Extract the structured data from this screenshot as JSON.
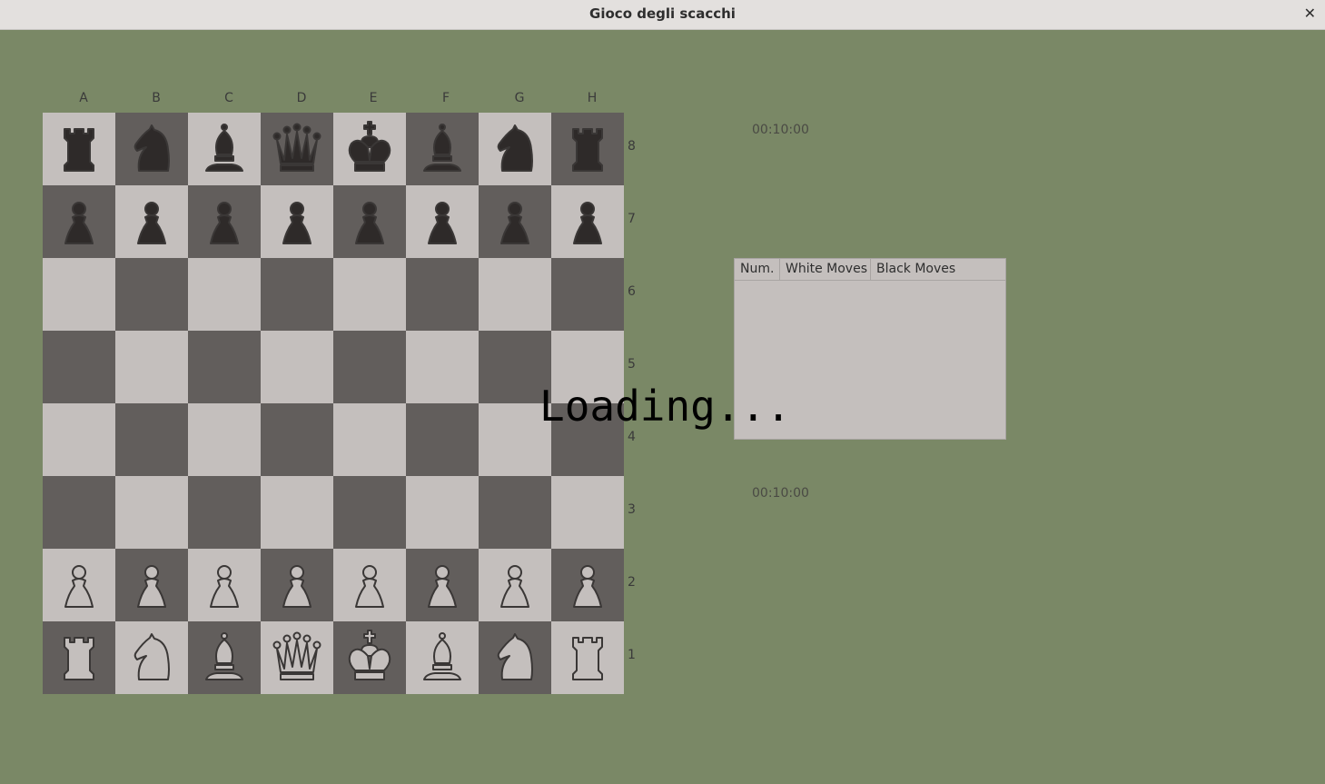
{
  "window": {
    "title": "Gioco degli scacchi",
    "close_glyph": "✕"
  },
  "board": {
    "files": [
      "A",
      "B",
      "C",
      "D",
      "E",
      "F",
      "G",
      "H"
    ],
    "ranks": [
      "8",
      "7",
      "6",
      "5",
      "4",
      "3",
      "2",
      "1"
    ],
    "pieces": [
      [
        "bR",
        "bN",
        "bB",
        "bQ",
        "bK",
        "bB",
        "bN",
        "bR"
      ],
      [
        "bP",
        "bP",
        "bP",
        "bP",
        "bP",
        "bP",
        "bP",
        "bP"
      ],
      [
        "",
        "",
        "",
        "",
        "",
        "",
        "",
        ""
      ],
      [
        "",
        "",
        "",
        "",
        "",
        "",
        "",
        ""
      ],
      [
        "",
        "",
        "",
        "",
        "",
        "",
        "",
        ""
      ],
      [
        "",
        "",
        "",
        "",
        "",
        "",
        "",
        ""
      ],
      [
        "wP",
        "wP",
        "wP",
        "wP",
        "wP",
        "wP",
        "wP",
        "wP"
      ],
      [
        "wR",
        "wN",
        "wB",
        "wQ",
        "wK",
        "wB",
        "wN",
        "wR"
      ]
    ],
    "colors": {
      "light": "#c4bfbd",
      "dark": "#625e5c",
      "white_piece": "#c4bfbd",
      "black_piece": "#2e2a29",
      "piece_outline": "#3a3736"
    }
  },
  "clocks": {
    "top": "00:10:00",
    "bottom": "00:10:00"
  },
  "moves_table": {
    "headers": [
      "Num.",
      "White Moves",
      "Black Moves"
    ],
    "rows": []
  },
  "overlay": {
    "text": "Loading..."
  }
}
